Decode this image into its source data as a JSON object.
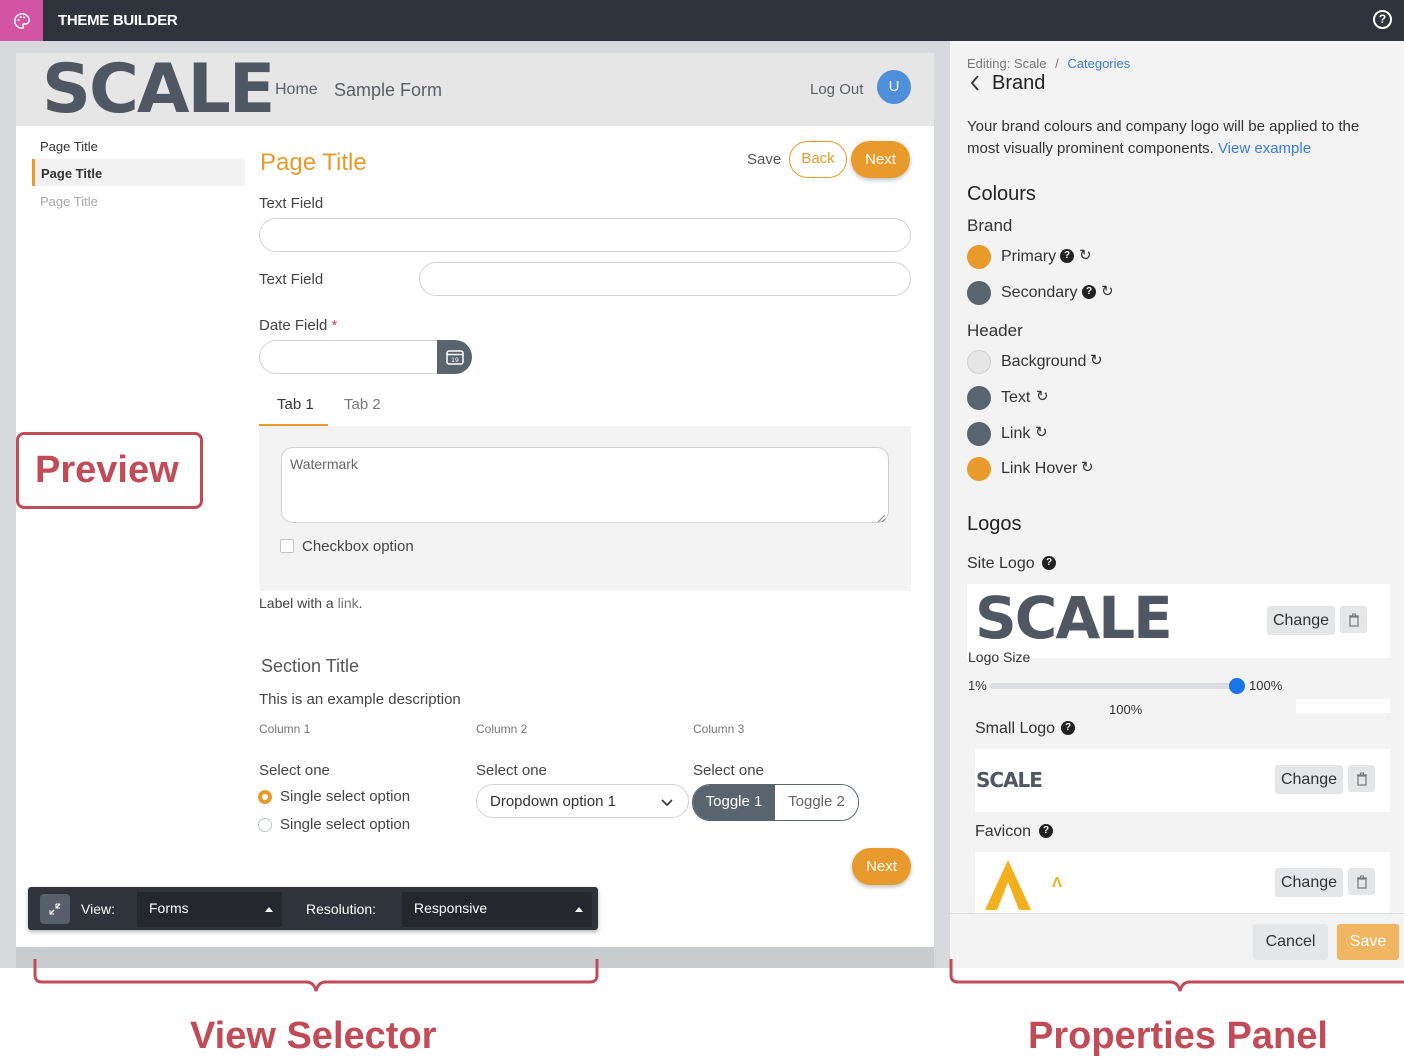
{
  "topbar": {
    "title": "THEME BUILDER",
    "app_icon": "palette-icon",
    "help_icon": "help-icon"
  },
  "preview_header": {
    "logo": "SCALE",
    "nav": [
      "Home",
      "Sample Form"
    ],
    "logout": "Log Out",
    "avatar": "U"
  },
  "left_nav": {
    "items": [
      "Page Title",
      "Page Title",
      "Page Title"
    ],
    "selected_index": 1
  },
  "form": {
    "title": "Page Title",
    "save": "Save",
    "back": "Back",
    "next": "Next",
    "text_field_1_label": "Text Field",
    "text_field_2_label": "Text Field",
    "date_field_label": "Date Field",
    "required_mark": "*",
    "tabs": [
      "Tab 1",
      "Tab 2"
    ],
    "watermark_placeholder": "Watermark",
    "checkbox_label": "Checkbox option",
    "label_prefix": "Label with a ",
    "label_link": "link",
    "label_suffix": ".",
    "section_title": "Section Title",
    "section_description": "This is an example description",
    "columns": [
      "Column 1",
      "Column 2",
      "Column 3"
    ],
    "select_one": "Select one",
    "radio_options": [
      "Single select option",
      "Single select option"
    ],
    "dropdown_value": "Dropdown option 1",
    "toggles": [
      "Toggle 1",
      "Toggle 2"
    ],
    "next_bottom": "Next",
    "calendar_day": "19"
  },
  "view_selector": {
    "view_label": "View:",
    "view_value": "Forms",
    "resolution_label": "Resolution:",
    "resolution_value": "Responsive"
  },
  "properties": {
    "breadcrumb_editing": "Editing: Scale",
    "breadcrumb_sep": "/",
    "breadcrumb_link": "Categories",
    "back_title": "Brand",
    "intro": "Your brand colours and company logo will be applied to the most visually prominent components.",
    "intro_link": "View example",
    "colours_heading": "Colours",
    "brand_heading": "Brand",
    "brand_colours": [
      {
        "name": "Primary",
        "color": "#e99a2c",
        "help": true
      },
      {
        "name": "Secondary",
        "color": "#58656f",
        "help": true
      }
    ],
    "header_heading": "Header",
    "header_colours": [
      {
        "name": "Background",
        "color": "#e6e6e7"
      },
      {
        "name": "Text",
        "color": "#58656f"
      },
      {
        "name": "Link",
        "color": "#58656f"
      },
      {
        "name": "Link Hover",
        "color": "#e99a2c"
      }
    ],
    "logos_heading": "Logos",
    "site_logo_label": "Site Logo",
    "logo_size_label": "Logo Size",
    "slider_min": "1%",
    "slider_max": "100%",
    "slider_value_text": "100%",
    "slider_fraction": 1.0,
    "small_logo_label": "Small Logo",
    "favicon_label": "Favicon",
    "change_label": "Change",
    "cancel": "Cancel",
    "save": "Save",
    "logo_text": "SCALE",
    "favicon_small": "Λ"
  },
  "annotations": {
    "preview": "Preview",
    "view_selector": "View Selector",
    "properties_panel": "Properties Panel"
  },
  "colors": {
    "accent": "#e99a2c",
    "secondary": "#58656f",
    "annotation": "#c14c57",
    "link": "#3b7dd8"
  }
}
